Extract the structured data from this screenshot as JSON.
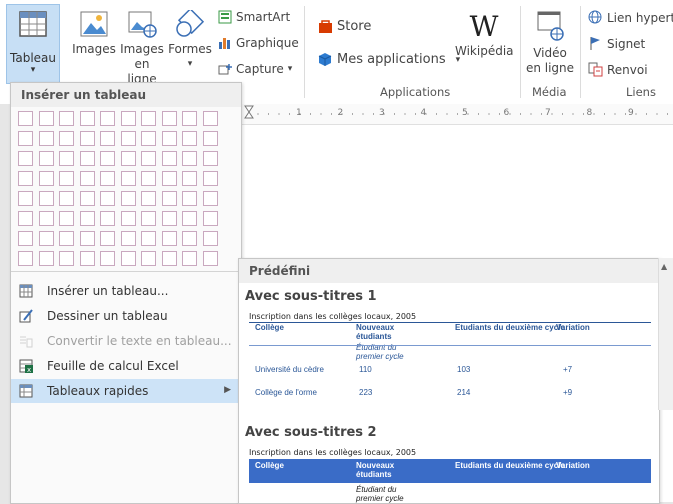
{
  "ribbon": {
    "tableau": {
      "label": "Tableau",
      "caret": "▾"
    },
    "images": {
      "label": "Images"
    },
    "images_en_ligne": {
      "line1": "Images",
      "line2": "en ligne"
    },
    "formes": {
      "label": "Formes",
      "caret": "▾"
    },
    "smartart": {
      "label": "SmartArt"
    },
    "graphique": {
      "label": "Graphique"
    },
    "capture": {
      "label": "Capture",
      "caret": "▾"
    },
    "store": {
      "label": "Store"
    },
    "mes_applications": {
      "label": "Mes applications",
      "caret": "▾"
    },
    "wikipedia": {
      "label": "Wikipédia"
    },
    "video": {
      "line1": "Vidéo",
      "line2": "en ligne"
    },
    "lien": {
      "label": "Lien hyperte"
    },
    "signet": {
      "label": "Signet"
    },
    "renvoi": {
      "label": "Renvoi"
    },
    "groups": {
      "applications": "Applications",
      "media": "Média",
      "liens": "Liens"
    }
  },
  "menu": {
    "header": "Insérer un tableau",
    "grid": {
      "rows": 8,
      "cols": 10
    },
    "items": [
      {
        "label": "Insérer un tableau...",
        "icon": "table-icon",
        "disabled": false
      },
      {
        "label": "Dessiner un tableau",
        "icon": "draw-table-icon",
        "disabled": false
      },
      {
        "label": "Convertir le texte en tableau...",
        "icon": "convert-icon",
        "disabled": true
      },
      {
        "label": "Feuille de calcul Excel",
        "icon": "excel-icon",
        "disabled": false
      },
      {
        "label": "Tableaux rapides",
        "icon": "quick-tables-icon",
        "disabled": false,
        "submenu": true
      }
    ]
  },
  "ruler": {
    "marks": [
      "1",
      "2",
      "3",
      "4",
      "5",
      "6",
      "7",
      "8",
      "9"
    ]
  },
  "gallery": {
    "header": "Prédéfini",
    "sections": [
      {
        "title": "Avec sous-titres 1",
        "caption": "Inscription dans les collèges locaux, 2005",
        "headers": [
          "Collège",
          "Nouveaux étudiants",
          "Etudiants du deuxième cycle",
          "Variation"
        ],
        "subheader": "Étudiant du premier cycle",
        "rows": [
          [
            "Université du cèdre",
            "110",
            "103",
            "+7"
          ],
          [
            "Collège de l'orme",
            "223",
            "214",
            "+9"
          ]
        ]
      },
      {
        "title": "Avec sous-titres 2",
        "caption": "Inscription dans les collèges locaux, 2005",
        "headers": [
          "Collège",
          "Nouveaux étudiants",
          "Etudiants du deuxième cycle",
          "Variation"
        ],
        "subheader": "Étudiant du premier cycle"
      }
    ]
  }
}
